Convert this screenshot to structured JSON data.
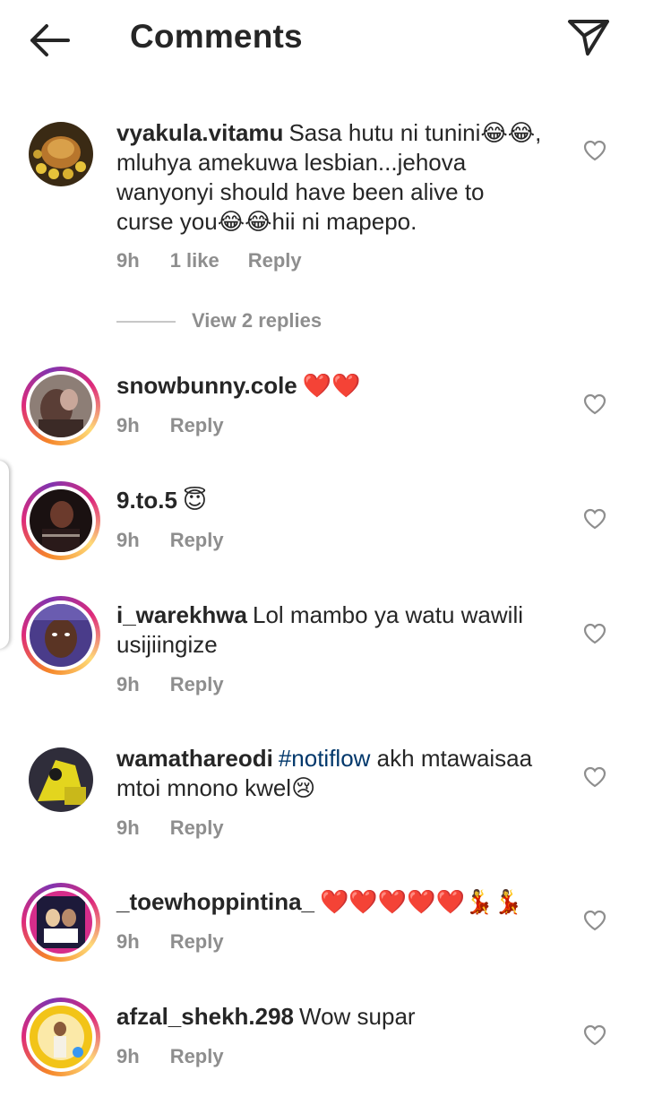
{
  "header": {
    "title": "Comments",
    "back_icon": "arrow-left-icon",
    "share_icon": "paper-plane-icon"
  },
  "view_replies": "View 2 replies",
  "comments": [
    {
      "username": "vyakula.vitamu",
      "text_parts": [
        "Sasa hutu ni tunini😂😂, mluhya amekuwa lesbian...jehova wanyonyi should have  been  alive to curse you😂😂hii ni mapepo."
      ],
      "time": "9h",
      "likes": "1 like",
      "reply": "Reply",
      "story_ring": false
    },
    {
      "username": "snowbunny.cole",
      "text_parts": [
        "❤️❤️"
      ],
      "time": "9h",
      "reply": "Reply",
      "story_ring": true
    },
    {
      "username": "9.to.5",
      "text_parts": [
        "😇"
      ],
      "time": "9h",
      "reply": "Reply",
      "story_ring": true
    },
    {
      "username": "i_warekhwa",
      "text_parts": [
        "Lol mambo ya watu wawili usijiingize"
      ],
      "time": "9h",
      "reply": "Reply",
      "story_ring": true
    },
    {
      "username": "wamathareodi",
      "hashtag": "#notiflow",
      "text_parts": [
        " akh mtawaisaa mtoi mnono kwel😢"
      ],
      "time": "9h",
      "reply": "Reply",
      "story_ring": false
    },
    {
      "username": "_toewhoppintina_",
      "text_parts": [
        "❤️❤️❤️❤️❤️💃💃"
      ],
      "time": "9h",
      "reply": "Reply",
      "story_ring": true
    },
    {
      "username": "afzal_shekh.298",
      "text_parts": [
        "Wow supar"
      ],
      "time": "9h",
      "reply": "Reply",
      "story_ring": true
    }
  ],
  "colors": {
    "text": "#262626",
    "meta": "#8e8e8e",
    "hashtag": "#00376b",
    "heart": "#ed1c24"
  }
}
